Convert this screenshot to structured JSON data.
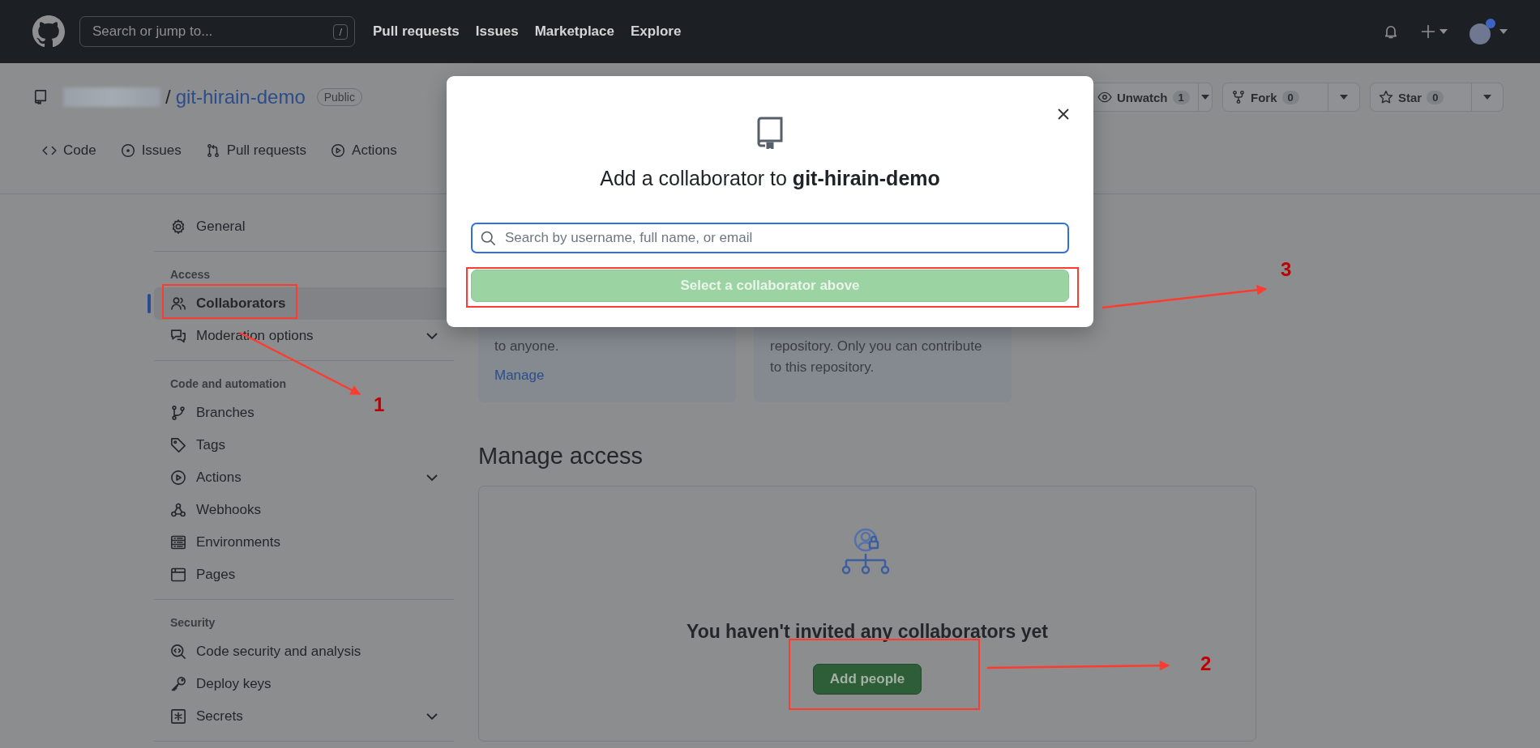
{
  "header": {
    "search_placeholder": "Search or jump to...",
    "search_key": "/",
    "nav": [
      "Pull requests",
      "Issues",
      "Marketplace",
      "Explore"
    ]
  },
  "repo": {
    "separator": "/",
    "name": "git-hirain-demo",
    "visibility": "Public",
    "actions": [
      {
        "label": "Unwatch",
        "count": "1"
      },
      {
        "label": "Fork",
        "count": "0"
      },
      {
        "label": "Star",
        "count": "0"
      }
    ],
    "tabs": [
      {
        "label": "Code",
        "selected": false
      },
      {
        "label": "Issues",
        "selected": false
      },
      {
        "label": "Pull requests",
        "selected": false
      },
      {
        "label": "Actions",
        "selected": false
      }
    ]
  },
  "sidebar": {
    "sections": [
      {
        "items": [
          {
            "label": "General",
            "selected": false,
            "expandable": false
          }
        ]
      },
      {
        "heading": "Access",
        "items": [
          {
            "label": "Collaborators",
            "selected": true,
            "expandable": false
          },
          {
            "label": "Moderation options",
            "selected": false,
            "expandable": true
          }
        ]
      },
      {
        "heading": "Code and automation",
        "items": [
          {
            "label": "Branches",
            "selected": false,
            "expandable": false
          },
          {
            "label": "Tags",
            "selected": false,
            "expandable": false
          },
          {
            "label": "Actions",
            "selected": false,
            "expandable": true
          },
          {
            "label": "Webhooks",
            "selected": false,
            "expandable": false
          },
          {
            "label": "Environments",
            "selected": false,
            "expandable": false
          },
          {
            "label": "Pages",
            "selected": false,
            "expandable": false
          }
        ]
      },
      {
        "heading": "Security",
        "items": [
          {
            "label": "Code security and analysis",
            "selected": false,
            "expandable": false
          },
          {
            "label": "Deploy keys",
            "selected": false,
            "expandable": false
          },
          {
            "label": "Secrets",
            "selected": false,
            "expandable": true
          }
        ]
      }
    ]
  },
  "cards": [
    {
      "lines": [
        "to anyone."
      ],
      "link": "Manage"
    },
    {
      "lines": [
        "repository. Only you can contribute",
        "to this repository."
      ]
    }
  ],
  "manage_access": {
    "heading": "Manage access",
    "empty_text": "You haven't invited any collaborators yet",
    "button": "Add people"
  },
  "dialog": {
    "title": "Add a collaborator to **git-hirain-demo**",
    "placeholder": "Search by username, full name, or email",
    "button": "Select a collaborator above",
    "button_disabled": true
  },
  "annotations": [
    {
      "label": "1"
    },
    {
      "label": "2"
    },
    {
      "label": "3"
    }
  ]
}
